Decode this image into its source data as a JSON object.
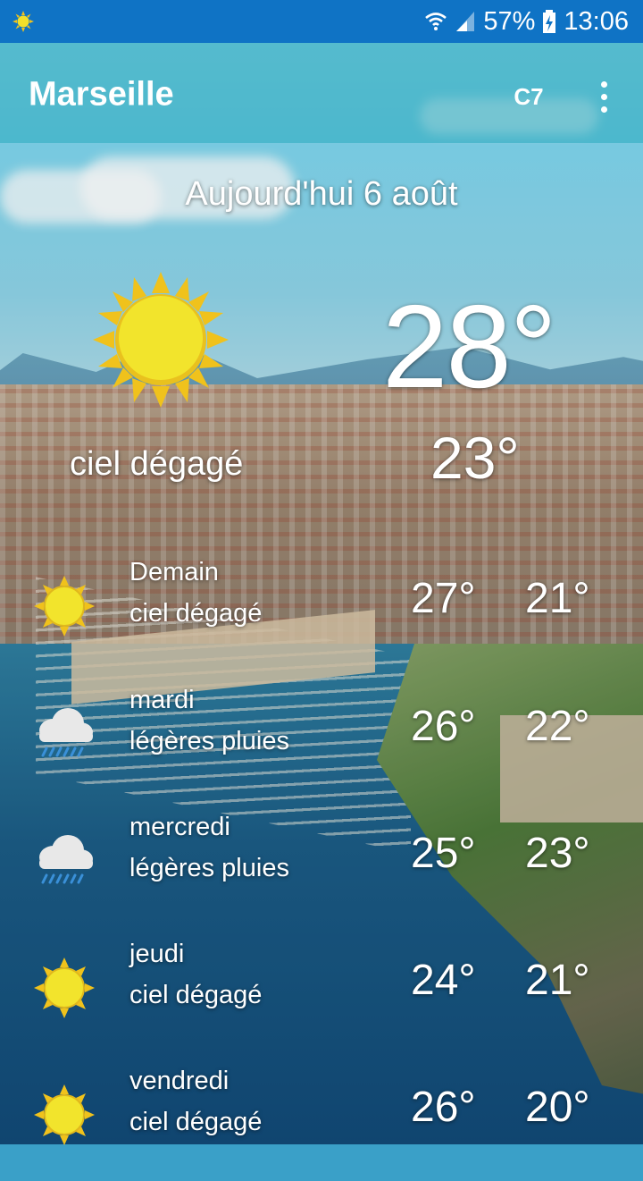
{
  "status_bar": {
    "battery": "57%",
    "time": "13:06",
    "left_icon": "sun-notification-icon",
    "icons": [
      "wifi-icon",
      "signal-icon",
      "battery-charging-icon"
    ]
  },
  "toolbar": {
    "city": "Marseille",
    "unit_label": "C7",
    "menu_icon": "overflow-menu-icon"
  },
  "today": {
    "date": "Aujourd'hui 6 août",
    "icon": "sun-icon",
    "condition": "ciel dégagé",
    "high": "28°",
    "low": "23°"
  },
  "forecast": [
    {
      "day": "Demain",
      "condition": "ciel dégagé",
      "high": "27°",
      "low": "21°",
      "icon": "sun-icon"
    },
    {
      "day": "mardi",
      "condition": "légères pluies",
      "high": "26°",
      "low": "22°",
      "icon": "rain-cloud-icon"
    },
    {
      "day": "mercredi",
      "condition": "légères pluies",
      "high": "25°",
      "low": "23°",
      "icon": "rain-cloud-icon"
    },
    {
      "day": "jeudi",
      "condition": "ciel dégagé",
      "high": "24°",
      "low": "21°",
      "icon": "sun-icon"
    },
    {
      "day": "vendredi",
      "condition": "ciel dégagé",
      "high": "26°",
      "low": "20°",
      "icon": "sun-icon"
    }
  ],
  "colors": {
    "status_bar": "#0f73c5",
    "sun_fill": "#f2e02a",
    "sun_rays": "#f0c21c",
    "cloud": "#e8e8e8",
    "rain": "#3a90d8"
  }
}
